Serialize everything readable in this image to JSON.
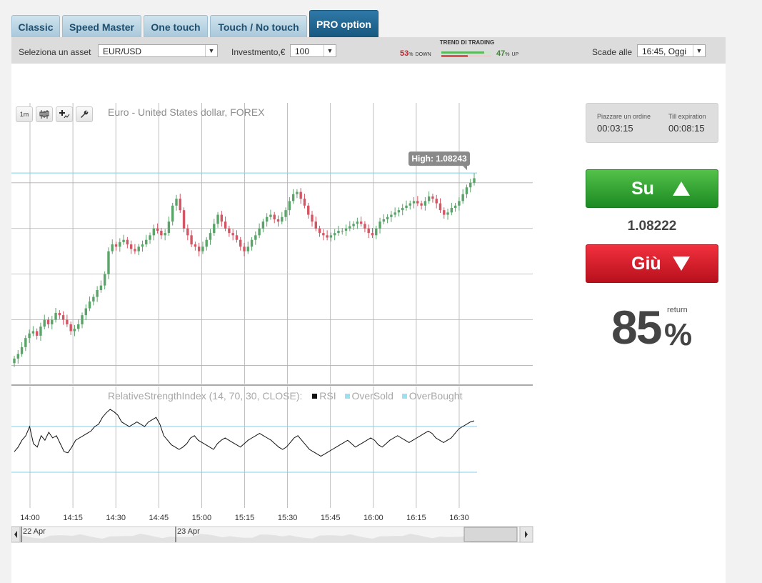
{
  "tabs": [
    {
      "label": "Classic",
      "active": false
    },
    {
      "label": "Speed Master",
      "active": false
    },
    {
      "label": "One touch",
      "active": false
    },
    {
      "label": "Touch / No touch",
      "active": false
    },
    {
      "label": "PRO option",
      "active": true
    }
  ],
  "toolbar": {
    "asset_label": "Seleziona un asset",
    "asset_value": "EUR/USD",
    "investment_label": "Investmento,€",
    "investment_value": "100",
    "trend_title": "TREND DI TRADING",
    "trend_down_pct": "53",
    "trend_down_label": "DOWN",
    "trend_up_pct": "47",
    "trend_up_label": "UP",
    "expiry_label": "Scade alle",
    "expiry_value": "16:45, Oggi",
    "pct_sign": "%"
  },
  "chart": {
    "title": "Euro - United States dollar, FOREX",
    "interval_button": "1m",
    "high_label": "High: 1.08243",
    "rsi_legend": "RelativeStrengthIndex (14, 70, 30, CLOSE):",
    "rsi_series": "RSI",
    "oversold_series": "OverSold",
    "overbought_series": "OverBought",
    "range_start": "22 Apr",
    "range_end": "23 Apr",
    "colors": {
      "up": "#5aa469",
      "down": "#d45563",
      "grid": "#b0b0b0",
      "hline": "#7fd0e8"
    }
  },
  "chart_data": {
    "type": "candlestick",
    "y_ticks": [
      "1.082",
      "1.080",
      "1.078",
      "1.076",
      "1.074"
    ],
    "ylim": [
      1.0732,
      1.0855
    ],
    "x_ticks": [
      "14:00",
      "14:15",
      "14:30",
      "14:45",
      "15:00",
      "15:15",
      "15:30",
      "15:45",
      "16:00",
      "16:15",
      "16:30"
    ],
    "high_value": 1.08243,
    "close_series": [
      1.0743,
      1.0745,
      1.0748,
      1.0752,
      1.0754,
      1.0755,
      1.0753,
      1.0757,
      1.076,
      1.0758,
      1.076,
      1.0763,
      1.0762,
      1.076,
      1.0758,
      1.0755,
      1.0756,
      1.0758,
      1.0762,
      1.0765,
      1.0768,
      1.077,
      1.0773,
      1.0775,
      1.078,
      1.079,
      1.0793,
      1.0792,
      1.0794,
      1.0795,
      1.0793,
      1.0791,
      1.079,
      1.0792,
      1.0793,
      1.0795,
      1.0797,
      1.08,
      1.0799,
      1.0797,
      1.0798,
      1.0803,
      1.081,
      1.0813,
      1.0808,
      1.08,
      1.0797,
      1.0793,
      1.0792,
      1.079,
      1.0792,
      1.0795,
      1.0798,
      1.0802,
      1.0806,
      1.0803,
      1.08,
      1.0798,
      1.0797,
      1.0795,
      1.0792,
      1.079,
      1.0792,
      1.0795,
      1.0797,
      1.08,
      1.0803,
      1.0805,
      1.0806,
      1.0804,
      1.0803,
      1.0805,
      1.0808,
      1.0812,
      1.0815,
      1.0816,
      1.0813,
      1.081,
      1.0806,
      1.0803,
      1.08,
      1.0798,
      1.0797,
      1.0796,
      1.0797,
      1.0798,
      1.0799,
      1.0799,
      1.08,
      1.0801,
      1.0802,
      1.0803,
      1.0802,
      1.08,
      1.0798,
      1.0797,
      1.08,
      1.0803,
      1.0804,
      1.0805,
      1.0806,
      1.0807,
      1.0808,
      1.0809,
      1.081,
      1.0811,
      1.0812,
      1.0811,
      1.081,
      1.0812,
      1.0814,
      1.0813,
      1.0811,
      1.0808,
      1.0806,
      1.0807,
      1.0809,
      1.081,
      1.0812,
      1.0815,
      1.0818,
      1.082,
      1.0822
    ],
    "rsi": [
      48,
      52,
      58,
      62,
      70,
      55,
      52,
      62,
      58,
      65,
      60,
      62,
      55,
      48,
      47,
      52,
      58,
      60,
      62,
      64,
      66,
      70,
      72,
      78,
      82,
      85,
      83,
      80,
      74,
      72,
      70,
      72,
      74,
      72,
      70,
      74,
      76,
      78,
      72,
      62,
      58,
      54,
      52,
      50,
      52,
      55,
      60,
      62,
      58,
      56,
      54,
      52,
      50,
      55,
      58,
      60,
      58,
      56,
      54,
      52,
      55,
      58,
      60,
      62,
      64,
      62,
      60,
      58,
      55,
      52,
      50,
      52,
      56,
      60,
      62,
      58,
      54,
      50,
      48,
      46,
      44,
      46,
      48,
      50,
      52,
      54,
      56,
      58,
      55,
      52,
      54,
      56,
      58,
      60,
      58,
      54,
      52,
      55,
      58,
      60,
      62,
      60,
      58,
      56,
      58,
      60,
      62,
      64,
      66,
      64,
      60,
      58,
      56,
      58,
      60,
      64,
      68,
      70,
      72,
      74,
      75
    ]
  },
  "trade_panel": {
    "place_order_label": "Piazzare un ordine",
    "place_order_time": "00:03:15",
    "till_expiry_label": "Till expiration",
    "till_expiry_time": "00:08:15",
    "up_button": "Su",
    "current_price": "1.08222",
    "down_button": "Giù",
    "return_value": "85",
    "return_pct": "%",
    "return_label": "return",
    "colors": {
      "up": "#2a9a2c",
      "down": "#d8192a"
    }
  }
}
